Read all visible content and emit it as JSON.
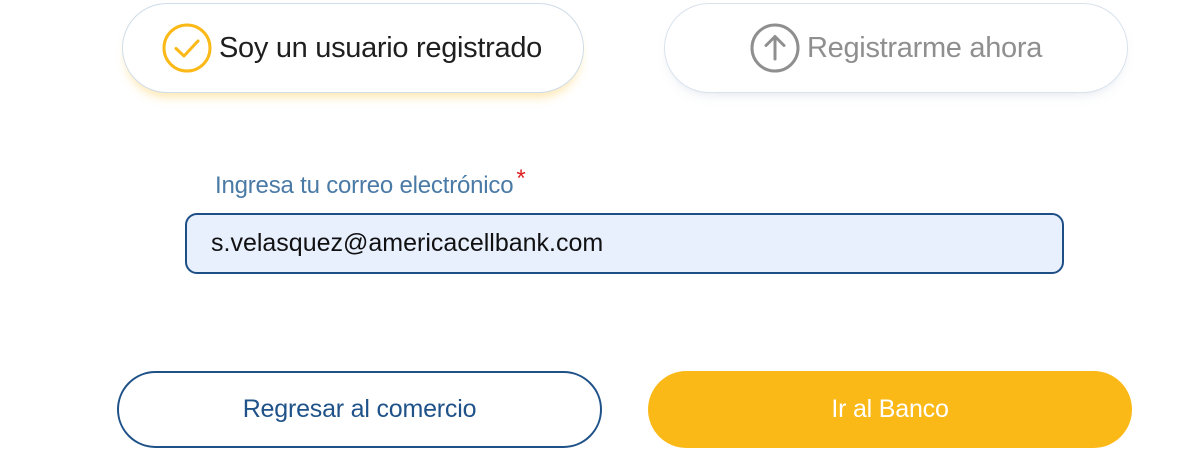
{
  "options": {
    "registered": {
      "label": "Soy un usuario registrado",
      "icon": "check-circle-icon",
      "selected": true,
      "accent_color": "#fbb918"
    },
    "register": {
      "label": "Registrarme ahora",
      "icon": "arrow-up-circle-icon",
      "selected": false
    }
  },
  "email_field": {
    "label": "Ingresa tu correo electrónico",
    "required_mark": "*",
    "value": "s.velasquez@americacellbank.com"
  },
  "actions": {
    "back_label": "Regresar al comercio",
    "bank_label": "Ir al Banco"
  },
  "colors": {
    "primary_blue": "#1f5289",
    "accent_yellow": "#fbb918",
    "required_red": "#e02020",
    "input_background": "#e8f0fe"
  }
}
